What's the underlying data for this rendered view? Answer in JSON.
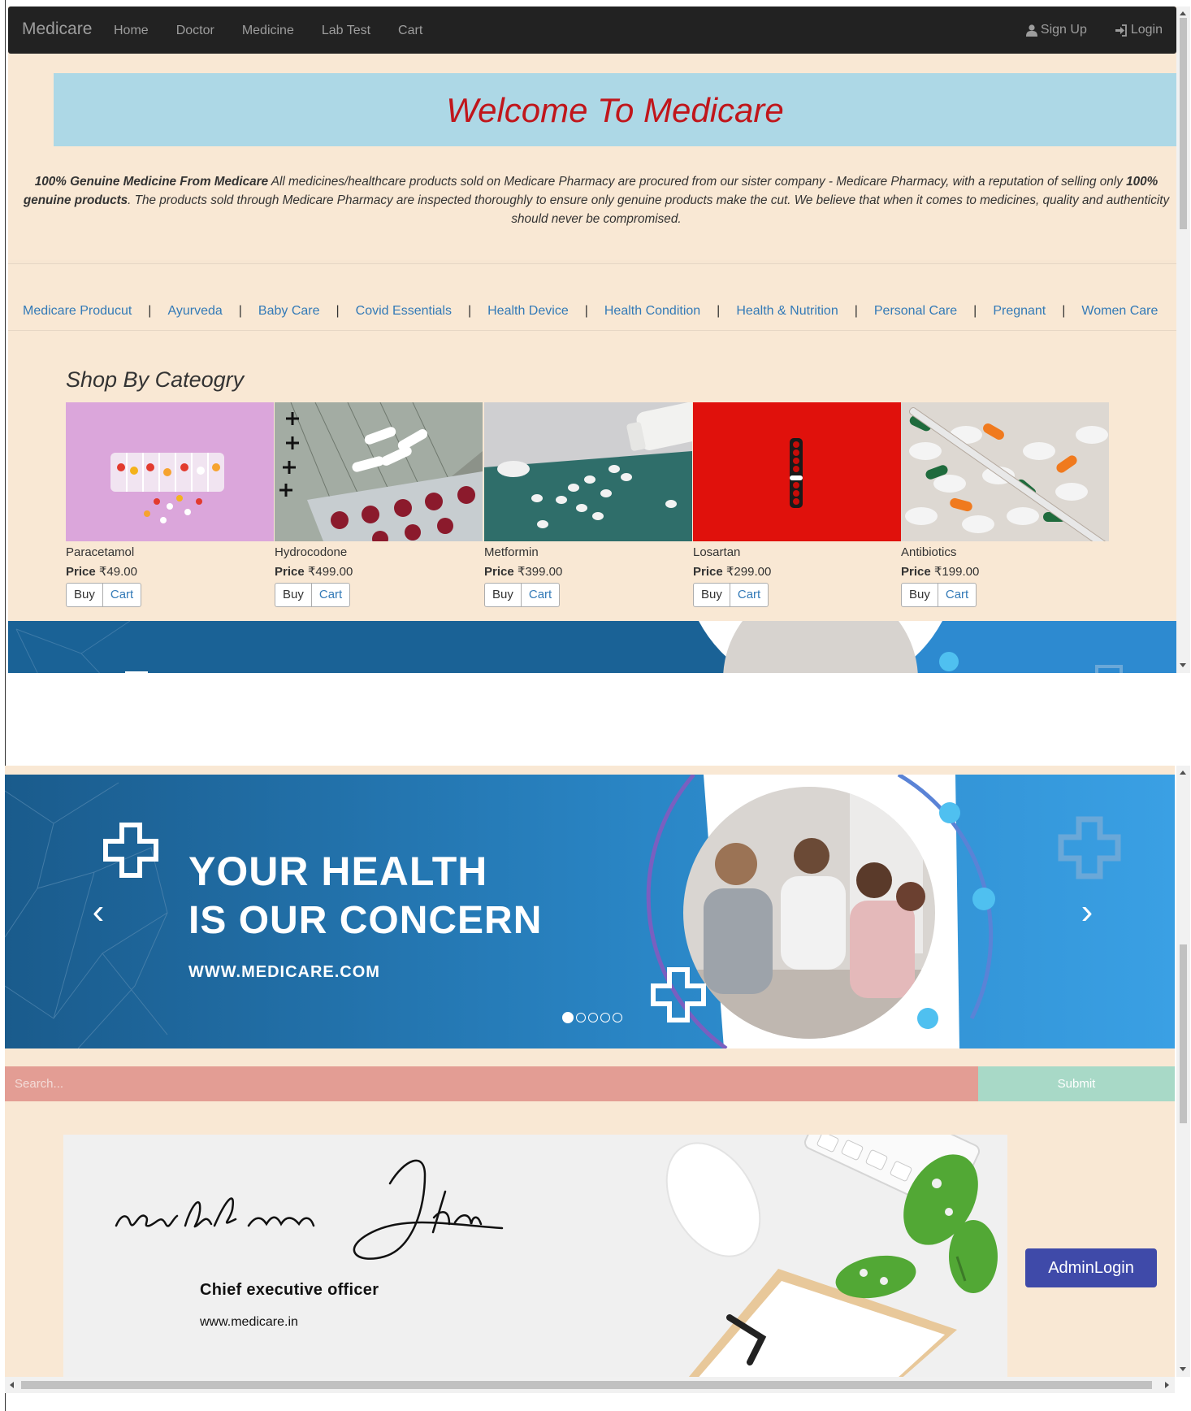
{
  "navbar": {
    "brand": "Medicare",
    "links": [
      "Home",
      "Doctor",
      "Medicine",
      "Lab Test",
      "Cart"
    ],
    "signup": "Sign Up",
    "login": "Login"
  },
  "welcome": "Welcome To Medicare",
  "intro": {
    "bold1": "100% Genuine Medicine From Medicare",
    "text1": " All medicines/healthcare products sold on Medicare Pharmacy are procured from our sister company - Medicare Pharmacy, with a reputation of selling only ",
    "bold2": "100% genuine products",
    "text2": ". The products sold through Medicare Pharmacy are inspected thoroughly to ensure only genuine products make the cut. We believe that when it comes to medicines, quality and authenticity should never be compromised."
  },
  "categories": [
    "Medicare Producut",
    "Ayurveda",
    "Baby Care",
    "Covid Essentials",
    "Health Device",
    "Health Condition",
    "Health & Nutrition",
    "Personal Care",
    "Pregnant",
    "Women Care"
  ],
  "shop_title": "Shop By Cateogry",
  "price_label": "Price",
  "buy_label": "Buy",
  "cart_label": "Cart",
  "products": [
    {
      "name": "Paracetamol",
      "price": "₹49.00"
    },
    {
      "name": "Hydrocodone",
      "price": "₹499.00"
    },
    {
      "name": "Metformin",
      "price": "₹399.00"
    },
    {
      "name": "Losartan",
      "price": "₹299.00"
    },
    {
      "name": "Antibiotics",
      "price": "₹199.00"
    }
  ],
  "banner": {
    "line1": "YOUR HEALTH",
    "line2": "IS OUR CONCERN",
    "url": "WWW.MEDICARE.COM",
    "slides": 5,
    "active_slide": 1
  },
  "search": {
    "placeholder": "Search...",
    "submit": "Submit"
  },
  "ceo": {
    "signature": "rohit kumar Jha",
    "title": "Chief executive officer",
    "url": "www.medicare.in"
  },
  "admin_login": "AdminLogin",
  "colors": {
    "navbar": "#222222",
    "page_bg": "#f9e8d4",
    "welcome_bg": "#add8e6",
    "welcome_text": "#c0161b",
    "link": "#337ab7",
    "search_bg": "#e39d94",
    "submit_bg": "#a8d9c7",
    "admin_bg": "#3f4aa9"
  }
}
